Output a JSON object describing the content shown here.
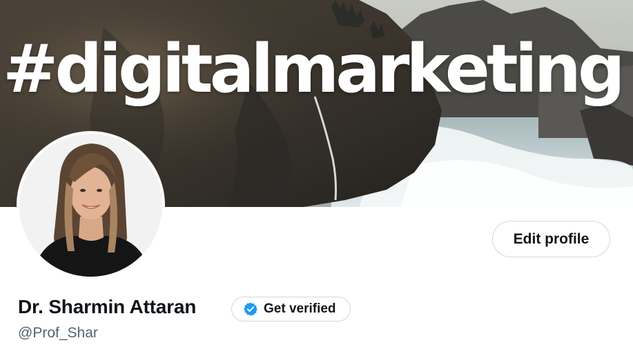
{
  "banner": {
    "hashtag_text": "#digitalmarketing"
  },
  "profile": {
    "display_name": "Dr. Sharmin Attaran",
    "handle": "@Prof_Shar",
    "edit_profile_label": "Edit profile",
    "get_verified_label": "Get verified"
  },
  "colors": {
    "text_primary": "#0f1419",
    "text_secondary": "#536471",
    "verified_badge": "#1d9bf0",
    "button_border": "#cfd9de"
  },
  "icons": {
    "verified": "verified-badge-icon"
  }
}
